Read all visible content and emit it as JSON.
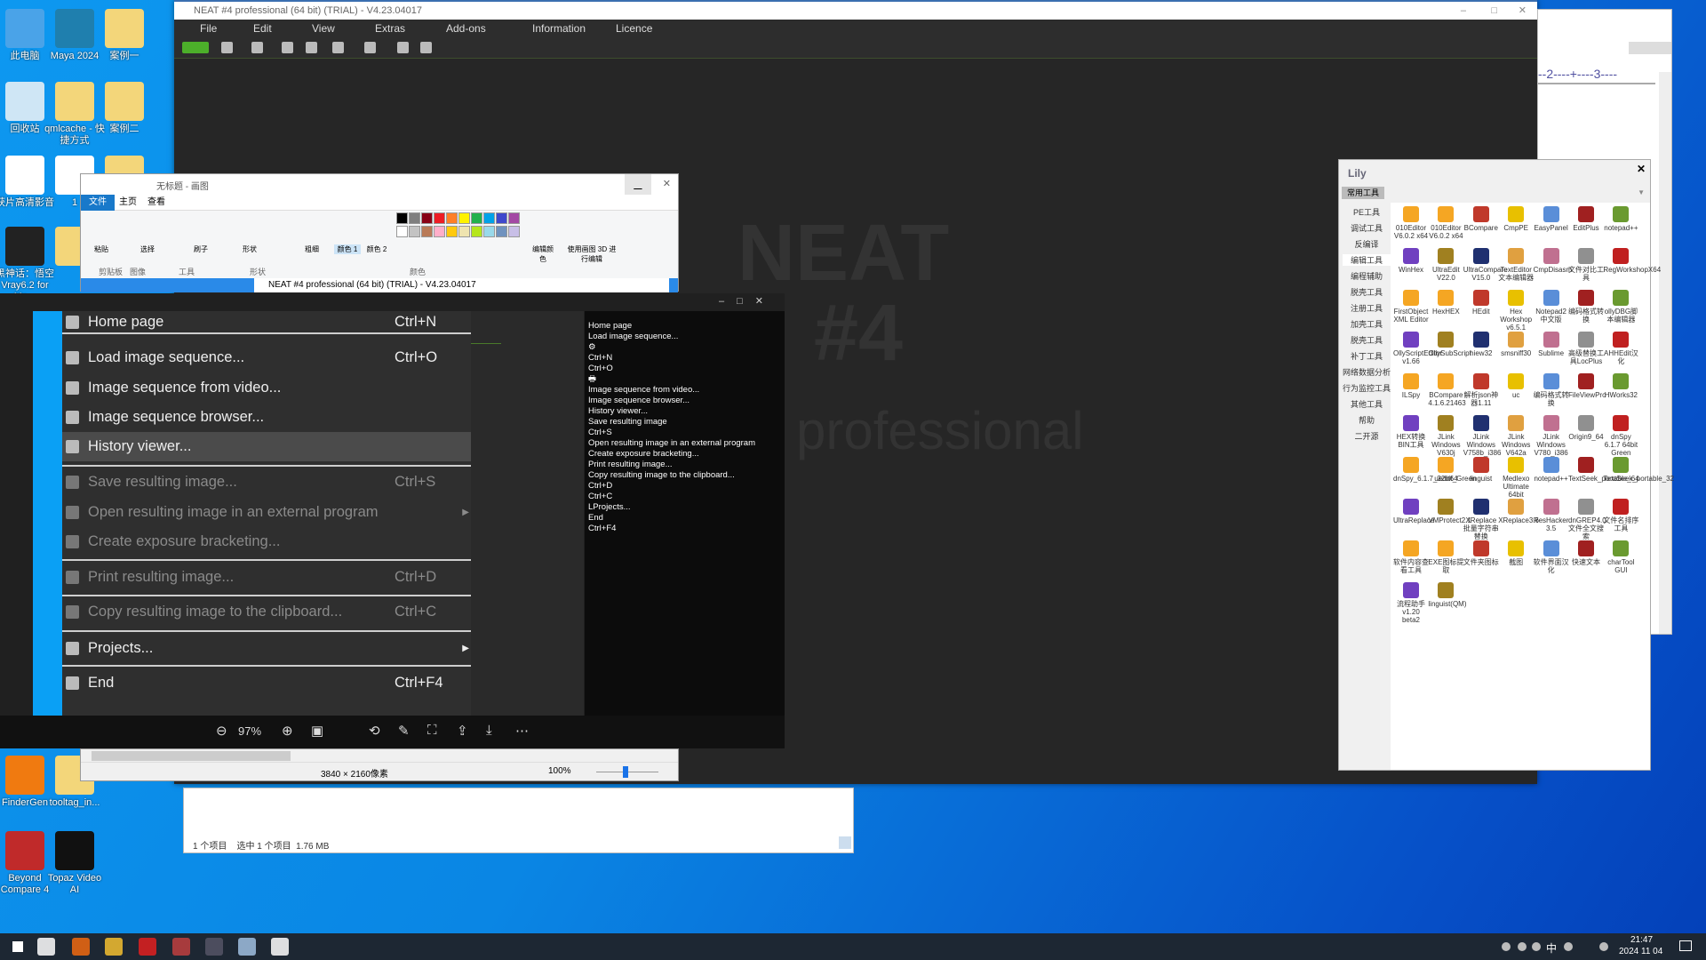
{
  "desktop": {
    "icons": [
      {
        "label": "此电脑",
        "color": "#4aa3e8"
      },
      {
        "label": "Maya 2024",
        "color": "#1f7fae"
      },
      {
        "label": "案例一",
        "color": "#f3d67a"
      },
      {
        "label": "回收站",
        "color": "#cfe6f5"
      },
      {
        "label": "qmlcache - 快捷方式",
        "color": "#f3d67a"
      },
      {
        "label": "案例二",
        "color": "#f3d67a"
      },
      {
        "label": "获片高清影音",
        "color": "#ffffff"
      },
      {
        "label": "1",
        "color": "#ffffff"
      },
      {
        "label": "",
        "color": "#f3d67a"
      },
      {
        "label": "黑神话：悟空 Vray6.2 for Ma...",
        "color": "#222222"
      },
      {
        "label": "",
        "color": "#f3d67a"
      },
      {
        "label": "FinderGen",
        "color": "#f07a10"
      },
      {
        "label": "tooltag_in...",
        "color": "#f3d67a"
      },
      {
        "label": "Beyond Compare 4",
        "color": "#c02a2a"
      },
      {
        "label": "Topaz Video AI",
        "color": "#111111"
      }
    ]
  },
  "neat": {
    "title": "NEAT #4 professional (64 bit) (TRIAL) - V4.23.04017",
    "menu": [
      "File",
      "Edit",
      "View",
      "Extras",
      "Add-ons",
      "Information",
      "Licence"
    ],
    "watermark": [
      "NEAT",
      "#4",
      "professional"
    ],
    "accent": "#4caf2a"
  },
  "paint": {
    "title": "无标题 - 画图",
    "tabs": [
      "文件",
      "主页",
      "查看"
    ],
    "groups": [
      "剪贴板",
      "图像",
      "工具",
      "形状",
      "颜色"
    ],
    "buttons": [
      "粘贴",
      "选择",
      "刷子",
      "形状",
      "粗细",
      "颜色 1",
      "颜色 2",
      "编辑颜色",
      "使用画图 3D 进行编辑"
    ],
    "inner_title": "NEAT #4 professional (64 bit) (TRIAL) - V4.23.04017",
    "palette": [
      "#000000",
      "#7f7f7f",
      "#880015",
      "#ed1c24",
      "#ff7f27",
      "#fff200",
      "#22b14c",
      "#00a2e8",
      "#3f48cc",
      "#a349a4",
      "#ffffff",
      "#c3c3c3",
      "#b97a57",
      "#ffaec9",
      "#ffc90e",
      "#efe4b0",
      "#b5e61d",
      "#99d9ea",
      "#7092be",
      "#c8bfe7"
    ],
    "status": {
      "size": "3840 × 2160像素",
      "zoom": "100%"
    }
  },
  "viewer": {
    "menu": [
      {
        "label": "Home page",
        "shortcut": "Ctrl+N",
        "disabled": false
      },
      {
        "label": "Load image sequence...",
        "shortcut": "Ctrl+O",
        "disabled": false
      },
      {
        "label": "Image sequence from video...",
        "shortcut": "",
        "disabled": false
      },
      {
        "label": "Image sequence browser...",
        "shortcut": "",
        "disabled": false
      },
      {
        "label": "History viewer...",
        "shortcut": "",
        "disabled": false,
        "highlighted": true
      },
      {
        "label": "Save resulting image...",
        "shortcut": "Ctrl+S",
        "disabled": true
      },
      {
        "label": "Open resulting image in an external program",
        "shortcut": "",
        "disabled": true,
        "submenu": true
      },
      {
        "label": "Create exposure bracketing...",
        "shortcut": "",
        "disabled": true
      },
      {
        "label": "Print resulting image...",
        "shortcut": "Ctrl+D",
        "disabled": true
      },
      {
        "label": "Copy resulting image to the clipboard...",
        "shortcut": "Ctrl+C",
        "disabled": true
      },
      {
        "label": "Projects...",
        "shortcut": "",
        "disabled": false,
        "submenu": true
      },
      {
        "label": "End",
        "shortcut": "Ctrl+F4",
        "disabled": false
      }
    ],
    "ocr_text": [
      "Home page",
      "Load image sequence...",
      "⚙",
      "Ctrl+N",
      "Ctrl+O",
      "🖶",
      "Image sequence from video...",
      "Image sequence browser...",
      "History viewer...",
      "Save resulting image",
      "Ctrl+S",
      "Open resulting image in an external program",
      "Create exposure bracketing...",
      "Print resulting image...",
      "Copy resulting image to the clipboard...",
      "Ctrl+D",
      "Ctrl+C",
      "LProjects...",
      "End",
      "Ctrl+F4"
    ],
    "zoom": "97%",
    "toolbar": [
      "zoom-out",
      "zoom-in",
      "actual-size",
      "rotate",
      "edit",
      "text-recognize",
      "share",
      "download",
      "more"
    ]
  },
  "explorer": {
    "status": "1 个项目    选中 1 个项目  1.76 MB"
  },
  "bgwin": {
    "ruler": "--2----+----3----"
  },
  "lily": {
    "title": "Lily",
    "dropdown": "常用工具",
    "nav": [
      "PE工具",
      "调试工具",
      "反编译",
      "编辑工具",
      "编程辅助",
      "脱壳工具",
      "注册工具",
      "加壳工具",
      "脱壳工具",
      "补丁工具",
      "网络数据分析",
      "行为监控工具",
      "其他工具",
      "帮助",
      "二开源"
    ],
    "items": [
      "010Editor V6.0.2 x64",
      "010Editor V6.0.2 x64",
      "BCompare",
      "CmpPE",
      "EasyPanel",
      "EditPlus",
      "notepad++",
      "WinHex",
      "UltraEdit V22.0",
      "UltraCompare V15.0",
      "TextEditor 文本编辑器",
      "CmpDisasm",
      "文件对比工具",
      "RegWorkshopX64",
      "FirstObject XML Editor",
      "HexHEX",
      "HEdit",
      "Hex Workshop v6.5.1",
      "Notepad2 中文版",
      "编码格式转换",
      "ollyDBG脚本编辑器",
      "OllyScriptEditor v1.66",
      "OllySubScript",
      "hiew32",
      "smsniff30",
      "Sublime",
      "高级替换工具LocPlus",
      "AHHEdit汉化",
      "ILSpy",
      "BCompare 4.1.6.21463",
      "解析json神器1.11",
      "uc",
      "编码格式转换",
      "FileViewPro",
      "HWorks32",
      "HEX转换BIN工具",
      "JLink Windows V630j",
      "JLink Windows V758b_i386",
      "JLink Windows V642a",
      "JLink Windows V780_i386",
      "Origin9_64",
      "dnSpy 6.1.7 64bit Green",
      "dnSpy_6.1.7_32bit_Green",
      "uedit64",
      "linguist",
      "Medlexo Ultimate 64bit",
      "notepad++",
      "TextSeek_portable_64",
      "TextSeek_portable_32",
      "UltraReplace",
      "VMProtect2.1",
      "XReplace批量字符串替换",
      "XReplace3.6",
      "ResHacker 3.5",
      "dnGREP4.0文件全文搜索",
      "文件名排序工具",
      "软件内容查看工具",
      "EXE图标提取",
      "文件夹图标",
      "截图",
      "软件界面汉化",
      "快速文本",
      "charTool GUI",
      "流程助手 v1.20 beta2",
      "linguist(QM)"
    ],
    "icon_colors": [
      "#f5a623",
      "#f5a623",
      "#c0392b",
      "#e8c000",
      "#5a8ed8",
      "#a02020",
      "#6a9a30",
      "#7040c0",
      "#a08020",
      "#203070",
      "#e0a040",
      "#c07090",
      "#909090",
      "#c02020"
    ]
  },
  "taskbar": {
    "time": "21:47",
    "date": "2024 11 04",
    "ime": "中",
    "apps": [
      "#ffffff",
      "#ffffff",
      "#f06a10",
      "#f3c030",
      "#e02020",
      "#c04040",
      "#556",
      "#a0c0e0",
      "#ffffff"
    ]
  }
}
